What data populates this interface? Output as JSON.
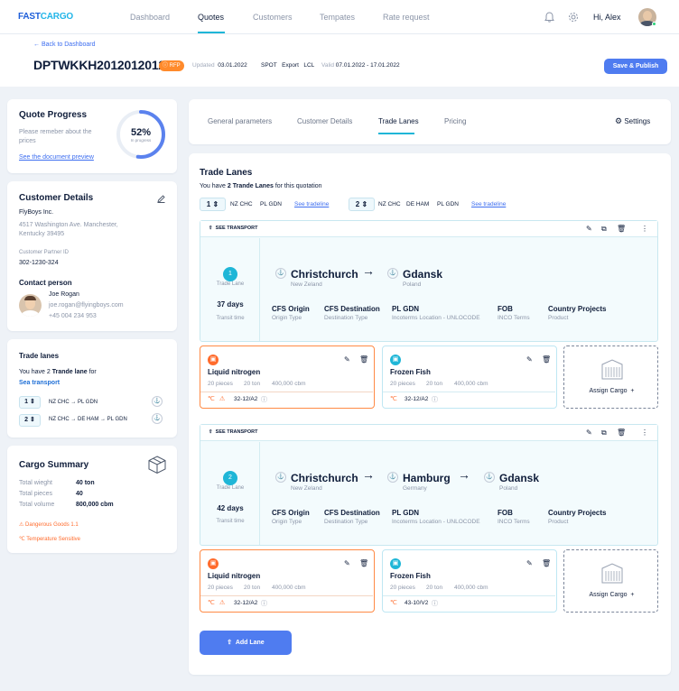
{
  "nav": {
    "logo_a": "FAST",
    "logo_b": "CARGO",
    "items": [
      "Dashboard",
      "Quotes",
      "Customers",
      "Tempates",
      "Rate request"
    ],
    "greeting": "Hi, Alex"
  },
  "header": {
    "back": "Back to Dashboard",
    "quote_id": "DPTWKKH20120120123",
    "badge": "RFP",
    "updated_label": "Updated",
    "updated": "03.01.2022",
    "spot": "SPOT",
    "export": "Export",
    "lcl": "LCL",
    "valid_label": "Valid",
    "valid": "07.01.2022 - 17.01.2022",
    "save": "Save & Publish"
  },
  "progress": {
    "title": "Quote Progress",
    "text": "Please remeber about the prices",
    "link": "See the  document preview",
    "percent": "52%",
    "sub": "In progress",
    "value": 0.52
  },
  "customer": {
    "title": "Customer Details",
    "company": "FlyBoys Inc.",
    "address": "4517 Washington Ave. Manchester, Kentucky 39495",
    "partner_label": "Customer Partner ID",
    "partner_id": "302-1230-324",
    "contact_label": "Contact person",
    "name": "Joe Rogan",
    "email": "joe.rogan@flyingboys.com",
    "phone": "+45 004 234 953"
  },
  "tradelanes_card": {
    "title": "Trade lanes",
    "text1": "You have 2",
    "bold": "Trande lane",
    "text2": "for",
    "mode": "Sea transport",
    "lanes": [
      {
        "n": "1",
        "route": "NZ CHC  →  PL GDN"
      },
      {
        "n": "2",
        "route": "NZ CHC  →  DE HAM  →  PL GDN"
      }
    ]
  },
  "cargo_summary": {
    "title": "Cargo Summary",
    "rows": [
      {
        "k": "Total wieght",
        "v": "40 ton"
      },
      {
        "k": "Total pieces",
        "v": "40"
      },
      {
        "k": "Total volume",
        "v": "800,000 cbm"
      }
    ],
    "dg": "Dangerous Goods 1.1",
    "temp": "Temperature Sensitive"
  },
  "tabs": [
    "General parameters",
    "Customer Details",
    "Trade Lanes",
    "Pricing"
  ],
  "settings": "Settings",
  "main": {
    "title": "Trade Lanes",
    "sub_a": "You have",
    "sub_b": "2 Trande Lanes",
    "sub_c": "for this quotation",
    "see_tradeline": "See tradeline",
    "see_transport": "SEE TRANSPORT",
    "add_lane": "Add Lane",
    "assign": "Assign Cargo",
    "trade_lane": "Trade Lane",
    "transit": "Transit time",
    "summary": [
      {
        "n": "1",
        "codes": [
          "NZ CHC",
          "PL GDN"
        ]
      },
      {
        "n": "2",
        "codes": [
          "NZ CHC",
          "DE HAM",
          "PL GDN"
        ]
      }
    ]
  },
  "lanes": [
    {
      "num": "1",
      "days": "37 days",
      "stops": [
        {
          "city": "Christchurch",
          "country": "New Zeland"
        },
        {
          "city": "Gdansk",
          "country": "Poland"
        }
      ],
      "terms": [
        {
          "v": "CFS Origin",
          "l": "Origin Type"
        },
        {
          "v": "CFS Destination",
          "l": "Destination Type"
        },
        {
          "v": "PL GDN",
          "l": "Incoterms Location - UNLOCODE"
        },
        {
          "v": "FOB",
          "l": "INCO Terms"
        },
        {
          "v": "Country Projects",
          "l": "Product"
        }
      ],
      "cargo": [
        {
          "name": "Liquid nitrogen",
          "pieces": "20 pieces",
          "ton": "20 ton",
          "cbm": "400,000 cbm",
          "code": "32-12/A2"
        },
        {
          "name": "Frozen Fish",
          "pieces": "20 pieces",
          "ton": "20 ton",
          "cbm": "400,000 cbm",
          "code": "32-12/A2"
        }
      ]
    },
    {
      "num": "2",
      "days": "42 days",
      "stops": [
        {
          "city": "Christchurch",
          "country": "New Zeland"
        },
        {
          "city": "Hamburg",
          "country": "Germany"
        },
        {
          "city": "Gdansk",
          "country": "Poland"
        }
      ],
      "terms": [
        {
          "v": "CFS Origin",
          "l": "Origin Type"
        },
        {
          "v": "CFS Destination",
          "l": "Destination Type"
        },
        {
          "v": "PL GDN",
          "l": "Incoterms Location - UNLOCODE"
        },
        {
          "v": "FOB",
          "l": "INCO Terms"
        },
        {
          "v": "Country Projects",
          "l": "Product"
        }
      ],
      "cargo": [
        {
          "name": "Liquid nitrogen",
          "pieces": "20 pieces",
          "ton": "20 ton",
          "cbm": "400,000 cbm",
          "code": "32-12/A2"
        },
        {
          "name": "Frozen Fish",
          "pieces": "20 pieces",
          "ton": "20 ton",
          "cbm": "400,000 cbm",
          "code": "43-10/V2"
        }
      ]
    }
  ],
  "colors": {
    "accent": "#4f7cf0",
    "teal": "#1fb6d7",
    "orange": "#ff8a45",
    "navy": "#0f1d3a"
  }
}
